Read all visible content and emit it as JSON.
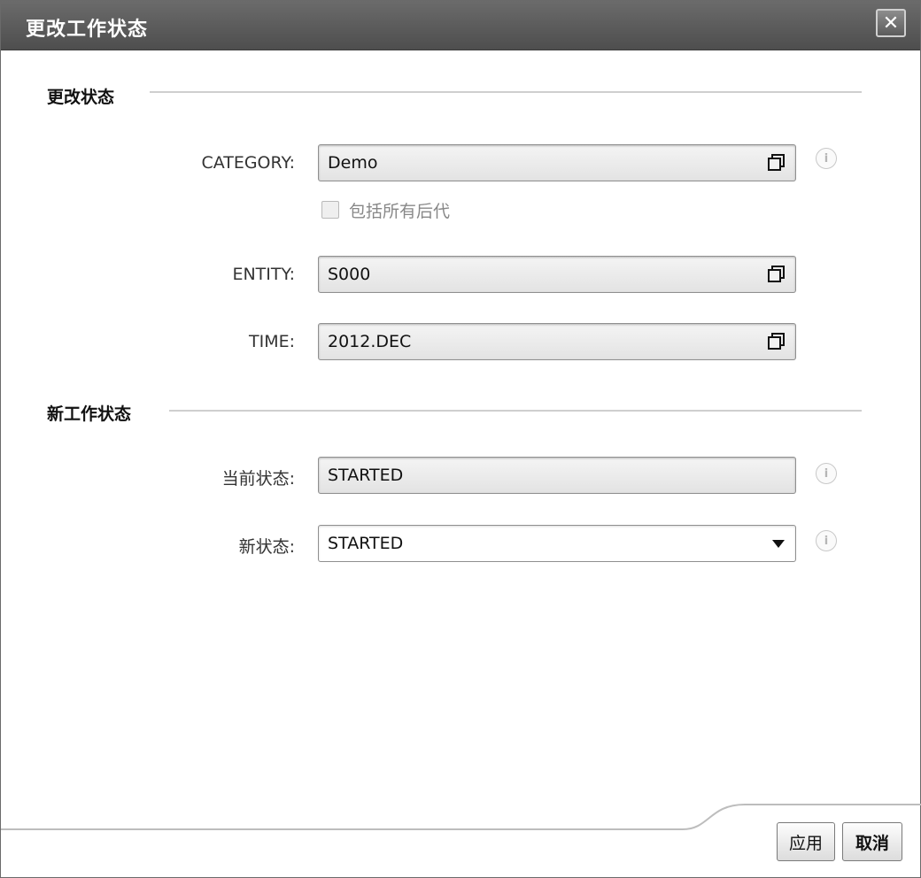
{
  "dialog": {
    "title": "更改工作状态",
    "close_icon": "close-icon"
  },
  "sections": {
    "change_status": "更改状态",
    "new_work_status": "新工作状态"
  },
  "fields": {
    "category": {
      "label": "CATEGORY:",
      "value": "Demo",
      "icon": "copy-icon"
    },
    "include_descendants": {
      "label": "包括所有后代",
      "checked": false
    },
    "entity": {
      "label": "ENTITY:",
      "value": "S000",
      "icon": "copy-icon"
    },
    "time": {
      "label": "TIME:",
      "value": "2012.DEC",
      "icon": "copy-icon"
    },
    "current_status": {
      "label": "当前状态:",
      "value": "STARTED"
    },
    "new_status": {
      "label": "新状态:",
      "value": "STARTED",
      "icon": "dropdown-arrow-icon"
    }
  },
  "info_icon_glyph": "i",
  "buttons": {
    "apply": "应用",
    "cancel": "取消"
  }
}
